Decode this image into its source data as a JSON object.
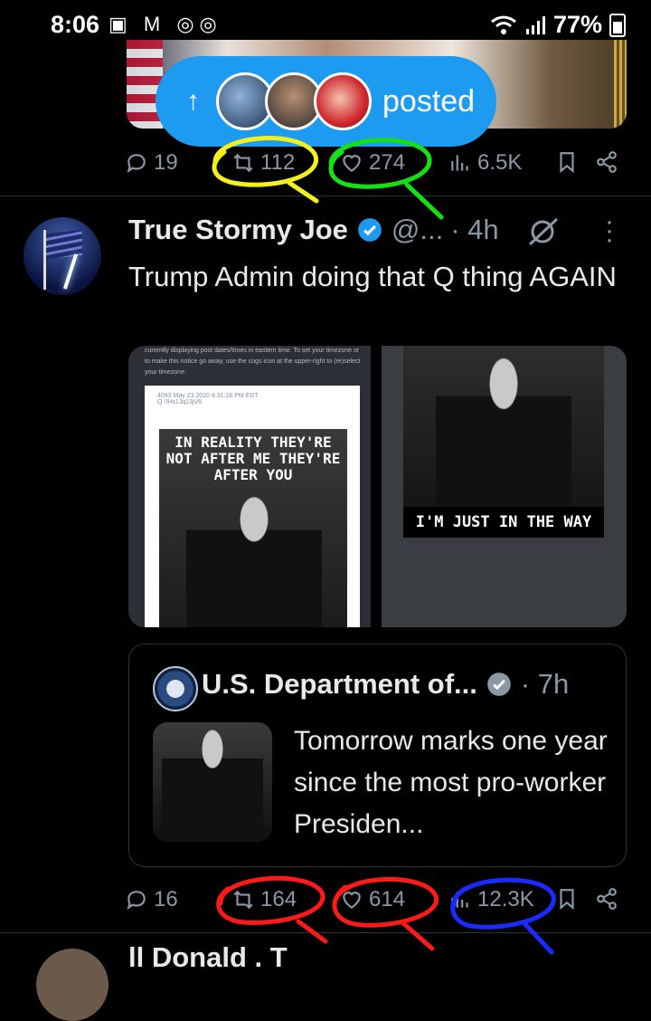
{
  "status_bar": {
    "time": "8:06",
    "notifications": "▣ M ◎◎",
    "battery": "77%"
  },
  "posted_pill": {
    "arrow": "↑",
    "label": "posted"
  },
  "prev_actions": {
    "replies": "19",
    "reposts": "112",
    "likes": "274",
    "views": "6.5K"
  },
  "tweet": {
    "name": "True Stormy Joe",
    "handle": "@...",
    "time": "· 4h",
    "text": "Trump Admin doing that Q thing AGAIN",
    "media": {
      "left_note": "currently displaying post dates/times in eastern time. To set your timezone or to make this notice go away, use the cogs icon at the upper-right to (re)select your timezone.",
      "left_header": "4093  May 23 2020 4:31:28 PM EDT",
      "left_header2": "Q  !!Hs1Jq13jV6",
      "left_caption": "IN REALITY THEY'RE NOT AFTER ME THEY'RE AFTER YOU",
      "right_caption": "I'M JUST IN THE WAY"
    },
    "quote": {
      "name": "U.S. Department of...",
      "time": "· 7h",
      "text": "Tomorrow marks one year since the most pro-worker Presiden..."
    },
    "actions": {
      "replies": "16",
      "reposts": "164",
      "likes": "614",
      "views": "12.3K"
    }
  },
  "next_tweet": {
    "name": "ll Donald . T"
  },
  "colors": {
    "accent": "#1d9bf0",
    "muted": "#8b98a5",
    "yellow": "#f5ef1a",
    "green": "#14e014",
    "red": "#ff1a1a",
    "blue": "#1a2bff"
  }
}
